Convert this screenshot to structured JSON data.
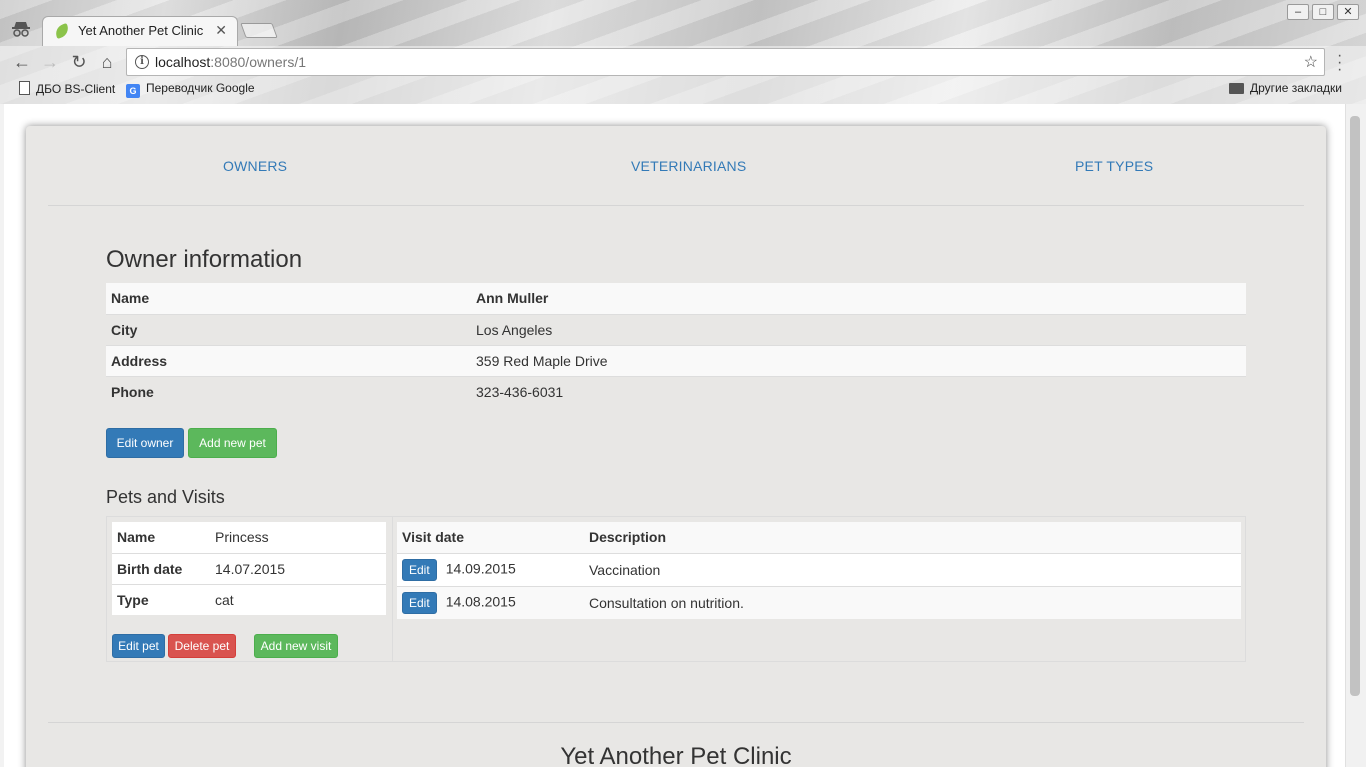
{
  "browser": {
    "tab_title": "Yet Another Pet Clinic",
    "tab_close": "✕",
    "url_host": "localhost",
    "url_path": ":8080/owners/1",
    "bookmarks": [
      "ДБО BS-Client",
      "Переводчик Google"
    ],
    "other_bookmarks": "Другие закладки"
  },
  "nav": {
    "owners": "OWNERS",
    "veterinarians": "VETERINARIANS",
    "pet_types": "PET TYPES"
  },
  "owner": {
    "heading": "Owner information",
    "rows": [
      {
        "label": "Name",
        "value": "Ann Muller"
      },
      {
        "label": "City",
        "value": "Los Angeles"
      },
      {
        "label": "Address",
        "value": "359 Red Maple Drive"
      },
      {
        "label": "Phone",
        "value": "323-436-6031"
      }
    ],
    "edit_button": "Edit owner",
    "add_pet_button": "Add new pet"
  },
  "pets": {
    "heading": "Pets and Visits",
    "pet": {
      "rows": [
        {
          "label": "Name",
          "value": "Princess"
        },
        {
          "label": "Birth date",
          "value": "14.07.2015"
        },
        {
          "label": "Type",
          "value": "cat"
        }
      ],
      "edit_button": "Edit pet",
      "delete_button": "Delete pet",
      "add_visit_button": "Add new visit"
    },
    "visits": {
      "headers": [
        "Visit date",
        "Description"
      ],
      "edit_label": "Edit",
      "rows": [
        {
          "date": "14.09.2015",
          "description": "Vaccination"
        },
        {
          "date": "14.08.2015",
          "description": "Consultation on nutrition."
        }
      ]
    }
  },
  "footer": {
    "title": "Yet Another Pet Clinic"
  },
  "colors": {
    "primary": "#337ab7",
    "success": "#5cb85c",
    "danger": "#d9534f",
    "container_bg": "#e8e7e5"
  }
}
